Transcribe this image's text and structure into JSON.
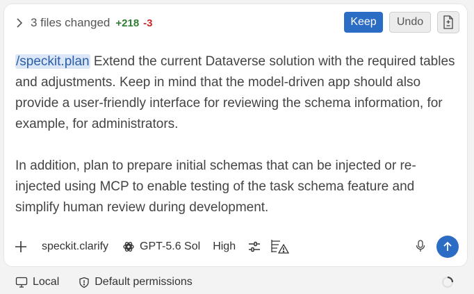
{
  "header": {
    "files_changed": "3 files changed",
    "additions": "+218",
    "deletions": "-3",
    "keep_label": "Keep",
    "undo_label": "Undo"
  },
  "prompt": {
    "command": "/speckit.plan",
    "paragraph1": " Extend the current Dataverse solution with the required tables and adjustments. Keep in mind that the model-driven app should also provide a user-friendly interface for reviewing the schema information, for example, for administrators.",
    "paragraph2": "In addition, plan to prepare initial schemas that can be injected or re-injected using MCP to enable testing of the task schema feature and simplify human review during development."
  },
  "toolbar": {
    "agent": "speckit.clarify",
    "model": "GPT-5.6 Sol",
    "effort": "High"
  },
  "status": {
    "location": "Local",
    "permissions": "Default permissions"
  },
  "colors": {
    "accent": "#2b6cc4",
    "added": "#2e7d32",
    "removed": "#c62828",
    "command_highlight": "#dbe7f7"
  }
}
